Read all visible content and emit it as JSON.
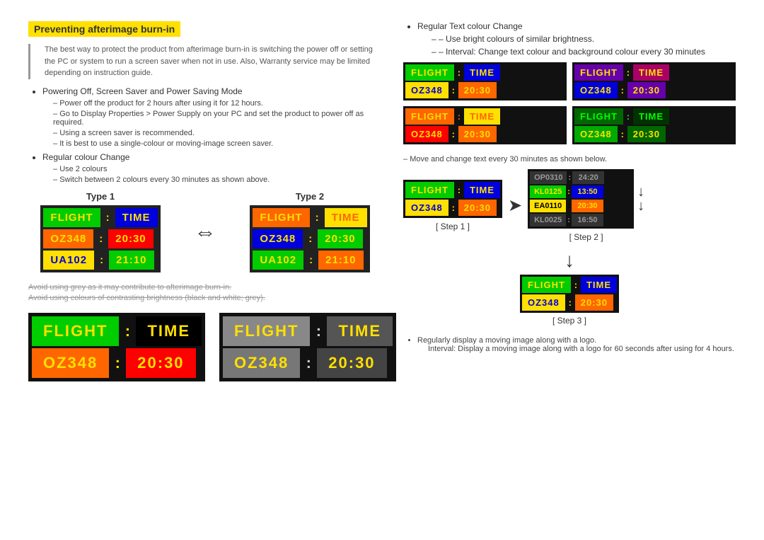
{
  "page": {
    "title": "Preventing afterimage burn-in"
  },
  "left": {
    "intro": "The best way to protect the product from afterimage burn-in is switching the power off or setting the PC or system to run a screen saver when not in use. Also, Warranty service may be limited depending on instruction guide.",
    "bullet1_title": "Powering Off, Screen Saver and Power Saving Mode",
    "bullet1_items": [
      "Power off the product for 2 hours after using it for 12 hours.",
      "Go to Display Properties > Power Supply on your PC and set the product to power off as required.",
      "Using a screen saver is recommended.",
      "It is best to use a single-colour or moving-image screen saver."
    ],
    "bullet2_title": "Regular colour Change",
    "bullet2_items": [
      "Use 2 colours",
      "Switch between 2 colours every 30 minutes as shown above."
    ],
    "type1_label": "Type 1",
    "type2_label": "Type 2",
    "flight_label": "FLIGHT",
    "time_label": "TIME",
    "colon": ":",
    "oz348": "OZ348",
    "ua102": "UA102",
    "t2030": "20:30",
    "t2110": "21:10",
    "avoid1": "Avoid using grey as it may contribute to afterimage burn-in.",
    "avoid2": "Avoid using colours of contrasting brightness (black and white; grey).",
    "large_board1": {
      "flight": "FLIGHT",
      "colon": ":",
      "time": "TIME",
      "oz": "OZ348",
      "t": "20:30"
    },
    "large_board2": {
      "flight": "FLIGHT",
      "colon": ":",
      "time": "TIME",
      "oz": "OZ348",
      "t": "20:30"
    }
  },
  "right": {
    "bullet3_title": "Regular Text colour Change",
    "bullet3_items": [
      "Use bright colours of similar brightness.",
      "Interval: Change text colour and background colour every 30 minutes"
    ],
    "examples": [
      {
        "hf": "FLIGHT",
        "c1": ":",
        "ht": "TIME",
        "d1": "OZ348",
        "c2": ":",
        "d2": "20:30"
      },
      {
        "hf": "FLIGHT",
        "c1": ":",
        "ht": "TIME",
        "d1": "OZ348",
        "c2": ":",
        "d2": "20:30"
      },
      {
        "hf": "FLIGHT",
        "c1": ":",
        "ht": "TIME",
        "d1": "OZ348",
        "c2": ":",
        "d2": "20:30"
      },
      {
        "hf": "FLIGHT",
        "c1": ":",
        "ht": "TIME",
        "d1": "OZ348",
        "c2": ":",
        "d2": "20:30"
      }
    ],
    "move_note": "Move and change text every 30 minutes as shown below.",
    "step1_label": "[ Step 1 ]",
    "step2_label": "[ Step 2 ]",
    "step3_label": "[ Step 3 ]",
    "step1_board": {
      "flight": "FLIGHT",
      "colon": ":",
      "time": "TIME",
      "oz": "OZ348",
      "t": "20:30"
    },
    "step2_rows": [
      {
        "col1": "OP0310",
        "c": ":",
        "col2": "24:20"
      },
      {
        "col1": "KL0125",
        "c": ":",
        "col2": "13:50"
      },
      {
        "col1": "EA0110",
        "c": ":",
        "col2": "20:30"
      },
      {
        "col1": "KL0025",
        "c": ":",
        "col2": "16:50"
      }
    ],
    "step3_board": {
      "flight": "FLIGHT",
      "colon": ":",
      "time": "TIME",
      "oz": "OZ348",
      "t": "20:30"
    },
    "regular_note1": "Regularly display a moving image along with a logo.",
    "regular_note2": "Interval: Display a moving image along with a logo for 60 seconds after using for 4 hours."
  }
}
